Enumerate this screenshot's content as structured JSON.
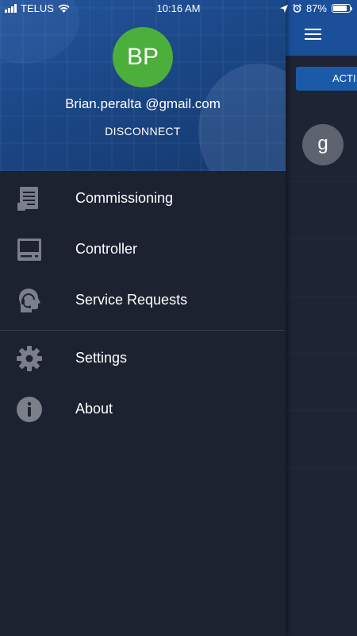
{
  "status_bar": {
    "carrier": "TELUS",
    "time": "10:16 AM",
    "battery_percent_label": "87%",
    "battery_level": 0.87
  },
  "drawer": {
    "user": {
      "initials": "BP",
      "email": "Brian.peralta @gmail.com",
      "avatar_color": "#4cae3b"
    },
    "disconnect_label": "DISCONNECT",
    "menu_primary": [
      {
        "label": "Commissioning",
        "icon": "document-icon"
      },
      {
        "label": "Controller",
        "icon": "computer-icon"
      },
      {
        "label": "Service Requests",
        "icon": "headset-icon"
      }
    ],
    "menu_secondary": [
      {
        "label": "Settings",
        "icon": "gear-icon"
      },
      {
        "label": "About",
        "icon": "info-icon"
      }
    ]
  },
  "main": {
    "active_tab_label": "ACTI",
    "device_initial": "g"
  },
  "colors": {
    "app_bar": "#1b4f9a",
    "drawer_bg": "#1c2230",
    "icon_gray": "#7a7f8a"
  }
}
